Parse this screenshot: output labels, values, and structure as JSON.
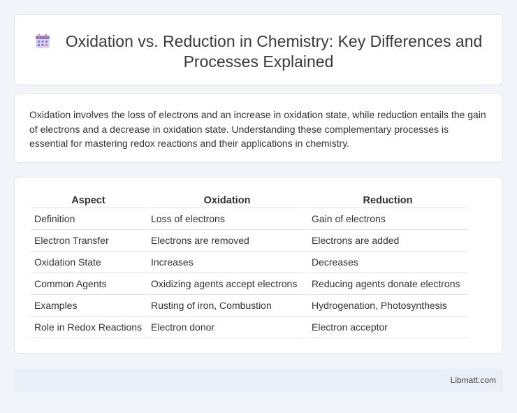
{
  "header": {
    "icon": "calendar-icon",
    "title": "Oxidation vs. Reduction in Chemistry: Key Differences and Processes Explained"
  },
  "summary": {
    "text": "Oxidation involves the loss of electrons and an increase in oxidation state, while reduction entails the gain of electrons and a decrease in oxidation state. Understanding these complementary processes is essential for mastering redox reactions and their applications in chemistry."
  },
  "table": {
    "headers": [
      "Aspect",
      "Oxidation",
      "Reduction"
    ],
    "rows": [
      [
        "Definition",
        "Loss of electrons",
        "Gain of electrons"
      ],
      [
        "Electron Transfer",
        "Electrons are removed",
        "Electrons are added"
      ],
      [
        "Oxidation State",
        "Increases",
        "Decreases"
      ],
      [
        "Common Agents",
        "Oxidizing agents accept electrons",
        "Reducing agents donate electrons"
      ],
      [
        "Examples",
        "Rusting of iron, Combustion",
        "Hydrogenation, Photosynthesis"
      ],
      [
        "Role in Redox Reactions",
        "Electron donor",
        "Electron acceptor"
      ]
    ]
  },
  "footer": {
    "text": "Libmatt.com"
  },
  "colors": {
    "background": "#f1f4f9",
    "card": "#ffffff",
    "footer": "#e9eef7",
    "icon_purple": "#8e7cc3",
    "icon_pink": "#e67fa8"
  }
}
